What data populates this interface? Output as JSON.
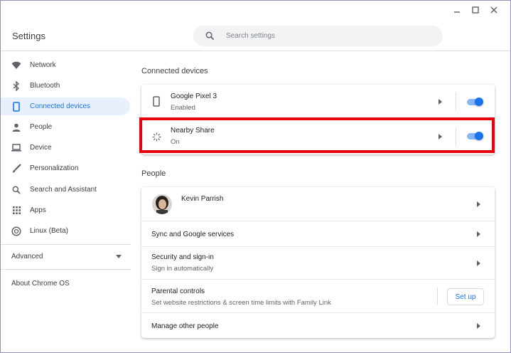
{
  "window": {
    "title": "Settings"
  },
  "search": {
    "placeholder": "Search settings"
  },
  "sidebar": {
    "items": [
      {
        "label": "Network",
        "icon": "wifi-icon"
      },
      {
        "label": "Bluetooth",
        "icon": "bluetooth-icon"
      },
      {
        "label": "Connected devices",
        "icon": "phone-icon",
        "active": true
      },
      {
        "label": "People",
        "icon": "person-icon"
      },
      {
        "label": "Device",
        "icon": "laptop-icon"
      },
      {
        "label": "Personalization",
        "icon": "brush-icon"
      },
      {
        "label": "Search and Assistant",
        "icon": "search-icon"
      },
      {
        "label": "Apps",
        "icon": "apps-grid-icon"
      },
      {
        "label": "Linux (Beta)",
        "icon": "linux-icon"
      }
    ],
    "advanced": "Advanced",
    "about": "About Chrome OS"
  },
  "connected": {
    "title": "Connected devices",
    "rows": [
      {
        "title": "Google Pixel 3",
        "sub": "Enabled",
        "toggle_on": true
      },
      {
        "title": "Nearby Share",
        "sub": "On",
        "toggle_on": true
      }
    ]
  },
  "people": {
    "title": "People",
    "account_name": "Kevin Parrish",
    "sync": "Sync and Google services",
    "security_title": "Security and sign-in",
    "security_sub": "Sign in automatically",
    "parental_title": "Parental controls",
    "parental_sub": "Set website restrictions & screen time limits with Family Link",
    "setup_label": "Set up",
    "manage": "Manage other people"
  },
  "colors": {
    "accent": "#1a73e8",
    "active_bg": "#e8f0fe",
    "highlight": "#e8000b"
  }
}
